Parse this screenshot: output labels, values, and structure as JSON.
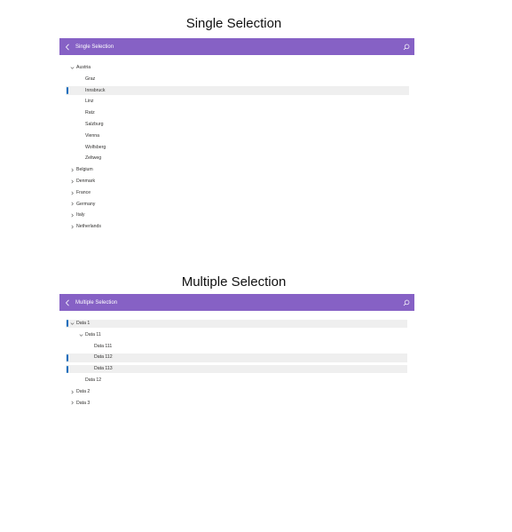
{
  "single": {
    "section_title": "Single Selection",
    "header_title": "Single Selection",
    "rows": [
      {
        "label": "Austria",
        "level": 0,
        "chevron": "down",
        "selected": false
      },
      {
        "label": "Graz",
        "level": 1,
        "chevron": "none",
        "selected": false
      },
      {
        "label": "Innsbruck",
        "level": 1,
        "chevron": "none",
        "selected": true
      },
      {
        "label": "Linz",
        "level": 1,
        "chevron": "none",
        "selected": false
      },
      {
        "label": "Ratz",
        "level": 1,
        "chevron": "none",
        "selected": false
      },
      {
        "label": "Salzburg",
        "level": 1,
        "chevron": "none",
        "selected": false
      },
      {
        "label": "Vienna",
        "level": 1,
        "chevron": "none",
        "selected": false
      },
      {
        "label": "Wolfsberg",
        "level": 1,
        "chevron": "none",
        "selected": false
      },
      {
        "label": "Zeltweg",
        "level": 1,
        "chevron": "none",
        "selected": false
      },
      {
        "label": "Belgium",
        "level": 0,
        "chevron": "right",
        "selected": false
      },
      {
        "label": "Denmark",
        "level": 0,
        "chevron": "right",
        "selected": false
      },
      {
        "label": "France",
        "level": 0,
        "chevron": "right",
        "selected": false
      },
      {
        "label": "Germany",
        "level": 0,
        "chevron": "right",
        "selected": false
      },
      {
        "label": "Italy",
        "level": 0,
        "chevron": "right",
        "selected": false
      },
      {
        "label": "Netherlands",
        "level": 0,
        "chevron": "right",
        "selected": false
      }
    ]
  },
  "multi": {
    "section_title": "Multiple Selection",
    "header_title": "Multiple Selection",
    "rows": [
      {
        "label": "Data 1",
        "level": 0,
        "chevron": "down",
        "selected": true
      },
      {
        "label": "Data 11",
        "level": 1,
        "chevron": "down",
        "selected": false
      },
      {
        "label": "Data 111",
        "level": 2,
        "chevron": "none",
        "selected": false
      },
      {
        "label": "Data 112",
        "level": 2,
        "chevron": "none",
        "selected": true
      },
      {
        "label": "Data 113",
        "level": 2,
        "chevron": "none",
        "selected": true
      },
      {
        "label": "Data 12",
        "level": 1,
        "chevron": "none",
        "selected": false
      },
      {
        "label": "Data 2",
        "level": 0,
        "chevron": "right",
        "selected": false
      },
      {
        "label": "Data 3",
        "level": 0,
        "chevron": "right",
        "selected": false
      }
    ]
  },
  "colors": {
    "header_bg": "#8661c5",
    "selection_bar": "#0f6cbd",
    "selected_row_bg": "#efefef"
  },
  "icons": {
    "back": "chevron-left-icon",
    "search": "search-icon",
    "expanded": "chevron-down-icon",
    "collapsed": "chevron-right-icon"
  }
}
